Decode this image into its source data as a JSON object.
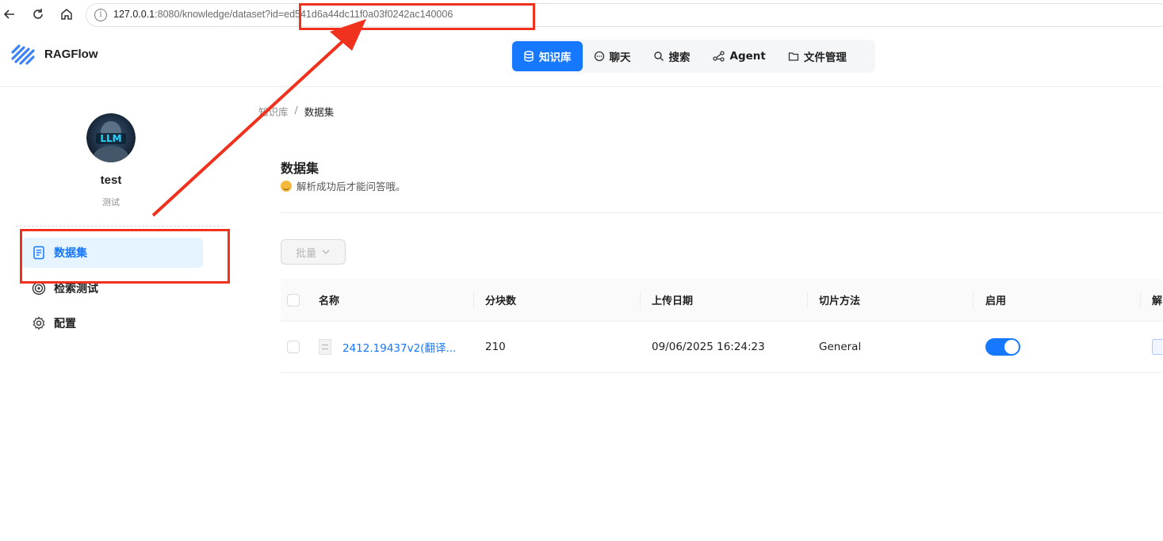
{
  "browser": {
    "url_host": "127.0.0.1",
    "url_rest": ":8080/knowledge/dataset?id=ed541d6a44dc11f0a03f0242ac140006"
  },
  "app": {
    "name": "RAGFlow",
    "nav": [
      {
        "label": "知识库",
        "icon": "database-icon",
        "active": true
      },
      {
        "label": "聊天",
        "icon": "chat-icon",
        "active": false
      },
      {
        "label": "搜索",
        "icon": "search-icon",
        "active": false
      },
      {
        "label": "Agent",
        "icon": "agent-icon",
        "active": false
      },
      {
        "label": "文件管理",
        "icon": "folder-icon",
        "active": false
      }
    ],
    "accent_color": "#1677ff"
  },
  "sidebar": {
    "avatar_text": "LLM",
    "kb_name": "test",
    "kb_description": "测试",
    "items": [
      {
        "label": "数据集",
        "icon": "document-icon",
        "active": true
      },
      {
        "label": "检索测试",
        "icon": "target-icon",
        "active": false
      },
      {
        "label": "配置",
        "icon": "gear-icon",
        "active": false
      }
    ]
  },
  "main": {
    "breadcrumb": [
      "知识库",
      "/",
      "数据集"
    ],
    "title": "数据集",
    "tip": "解析成功后才能问答哦。",
    "bulk_button": "批量",
    "table": {
      "columns": [
        "名称",
        "分块数",
        "上传日期",
        "切片方法",
        "启用",
        "解"
      ],
      "rows": [
        {
          "name": "2412.19437v2(翻译...",
          "chunks": "210",
          "upload_date": "09/06/2025 16:24:23",
          "method": "General",
          "enabled": true
        }
      ]
    }
  },
  "annotation": {
    "color": "#f0311e"
  }
}
